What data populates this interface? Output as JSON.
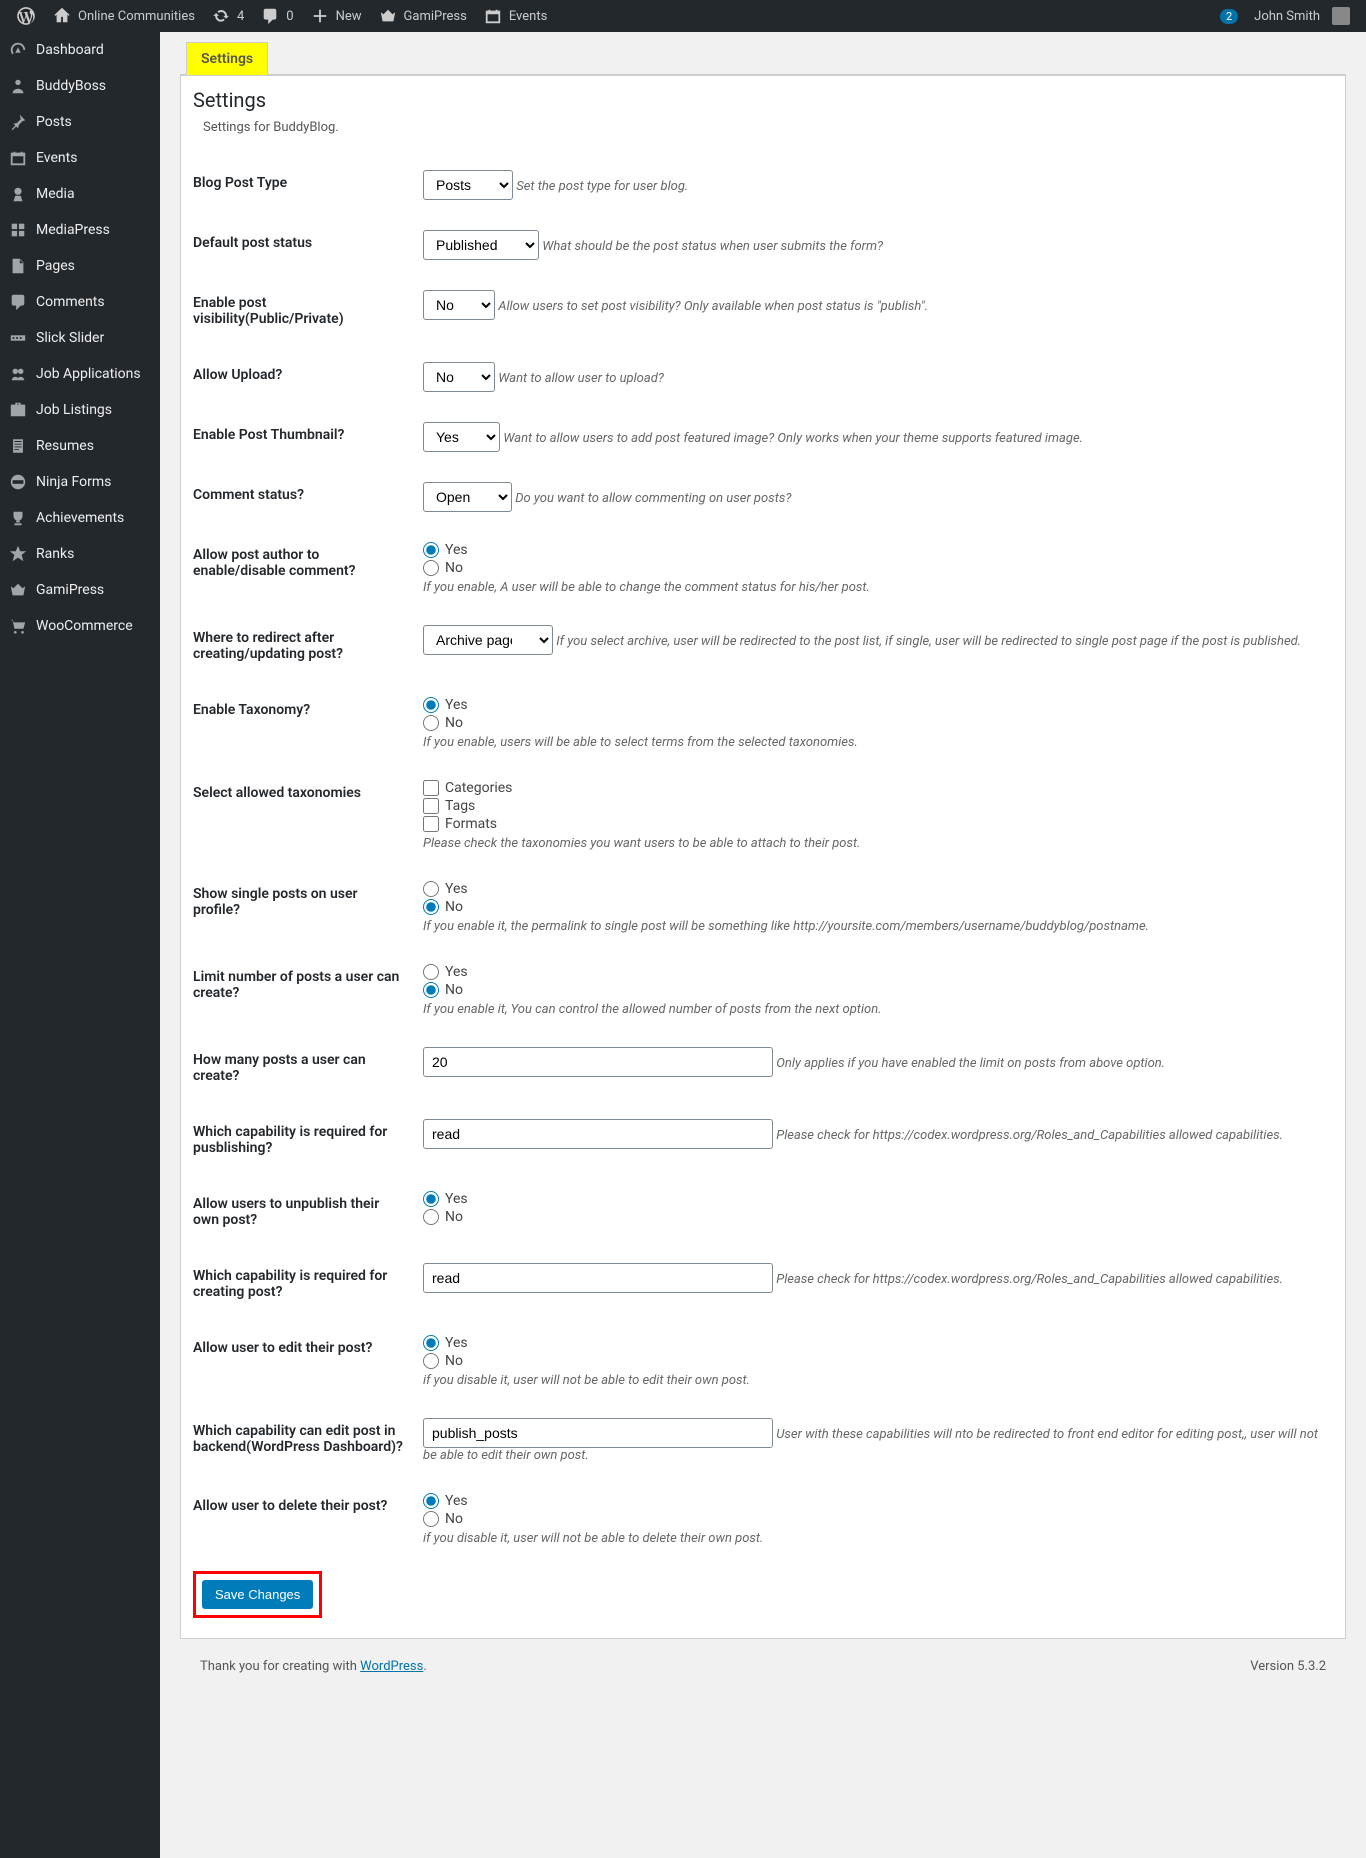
{
  "adminbar": {
    "site_name": "Online Communities",
    "updates": "4",
    "comments": "0",
    "new": "New",
    "gamipress": "GamiPress",
    "events": "Events",
    "notif_count": "2",
    "user": "John Smith"
  },
  "sidebar": {
    "items": [
      {
        "label": "Dashboard"
      },
      {
        "label": "BuddyBoss"
      },
      {
        "label": "Posts"
      },
      {
        "label": "Events"
      },
      {
        "label": "Media"
      },
      {
        "label": "MediaPress"
      },
      {
        "label": "Pages"
      },
      {
        "label": "Comments"
      },
      {
        "label": "Slick Slider"
      },
      {
        "label": "Job Applications"
      },
      {
        "label": "Job Listings"
      },
      {
        "label": "Resumes"
      },
      {
        "label": "Ninja Forms"
      },
      {
        "label": "Achievements"
      },
      {
        "label": "Ranks"
      },
      {
        "label": "GamiPress"
      },
      {
        "label": "WooCommerce"
      }
    ]
  },
  "tab_label": "Settings",
  "page_title": "Settings",
  "page_sub": "Settings for BuddyBlog.",
  "fields": {
    "post_type": {
      "label": "Blog Post Type",
      "value": "Posts",
      "desc": "Set the post type for user blog."
    },
    "post_status": {
      "label": "Default post status",
      "value": "Published",
      "desc": "What should be the post status when user submits the form?"
    },
    "visibility": {
      "label": "Enable post visibility(Public/Private)",
      "value": "No",
      "desc": "Allow users to set post visibility? Only available when post status is \"publish\"."
    },
    "allow_upload": {
      "label": "Allow Upload?",
      "value": "No",
      "desc": "Want to allow user to upload?"
    },
    "thumbnail": {
      "label": "Enable Post Thumbnail?",
      "value": "Yes",
      "desc": "Want to allow users to add post featured image? Only works when your theme supports featured image."
    },
    "comment_status": {
      "label": "Comment status?",
      "value": "Open",
      "desc": "Do you want to allow commenting on user posts?"
    },
    "author_comment": {
      "label": "Allow post author to enable/disable comment?",
      "opt_yes": "Yes",
      "opt_no": "No",
      "desc": "If you enable, A user will be able to change the comment status for his/her post."
    },
    "redirect": {
      "label": "Where to redirect after creating/updating post?",
      "value": "Archive page",
      "desc": "If you select archive, user will be redirected to the post list, if single, user will be redirected to single post page if the post is published."
    },
    "taxonomy": {
      "label": "Enable Taxonomy?",
      "opt_yes": "Yes",
      "opt_no": "No",
      "desc": "If you enable, users will be able to select terms from the selected taxonomies."
    },
    "allowed_tax": {
      "label": "Select allowed taxonomies",
      "opt1": "Categories",
      "opt2": "Tags",
      "opt3": "Formats",
      "desc": "Please check the taxonomies you want users to be able to attach to their post."
    },
    "show_single": {
      "label": "Show single posts on user profile?",
      "opt_yes": "Yes",
      "opt_no": "No",
      "desc": "If you enable it, the permalink to single post will be something like http://yoursite.com/members/username/buddyblog/postname."
    },
    "limit_posts": {
      "label": "Limit number of posts a user can create?",
      "opt_yes": "Yes",
      "opt_no": "No",
      "desc": "If you enable it, You can control the allowed number of posts from the next option."
    },
    "max_posts": {
      "label": "How many posts a user can create?",
      "value": "20",
      "desc": "Only applies if you have enabled the limit on posts from above option."
    },
    "cap_publish": {
      "label": "Which capability is required for pusblishing?",
      "value": "read",
      "desc": "Please check for https://codex.wordpress.org/Roles_and_Capabilities allowed capabilities."
    },
    "unpublish": {
      "label": "Allow users to unpublish their own post?",
      "opt_yes": "Yes",
      "opt_no": "No"
    },
    "cap_create": {
      "label": "Which capability is required for creating post?",
      "value": "read",
      "desc": "Please check for https://codex.wordpress.org/Roles_and_Capabilities allowed capabilities."
    },
    "allow_edit": {
      "label": "Allow user to edit their post?",
      "opt_yes": "Yes",
      "opt_no": "No",
      "desc": "if you disable it, user will not be able to edit their own post."
    },
    "cap_backend": {
      "label": "Which capability can edit post in backend(WordPress Dashboard)?",
      "value": "publish_posts",
      "desc": "User with these capabilities will nto be redirected to front end editor for editing post,, user will not be able to edit their own post."
    },
    "allow_delete": {
      "label": "Allow user to delete their post?",
      "opt_yes": "Yes",
      "opt_no": "No",
      "desc": "if you disable it, user will not be able to delete their own post."
    }
  },
  "yes": "Yes",
  "no": "No",
  "save_btn": "Save Changes",
  "footer": {
    "thank": "Thank you for creating with ",
    "wp": "WordPress",
    "dot": ".",
    "version": "Version 5.3.2"
  }
}
